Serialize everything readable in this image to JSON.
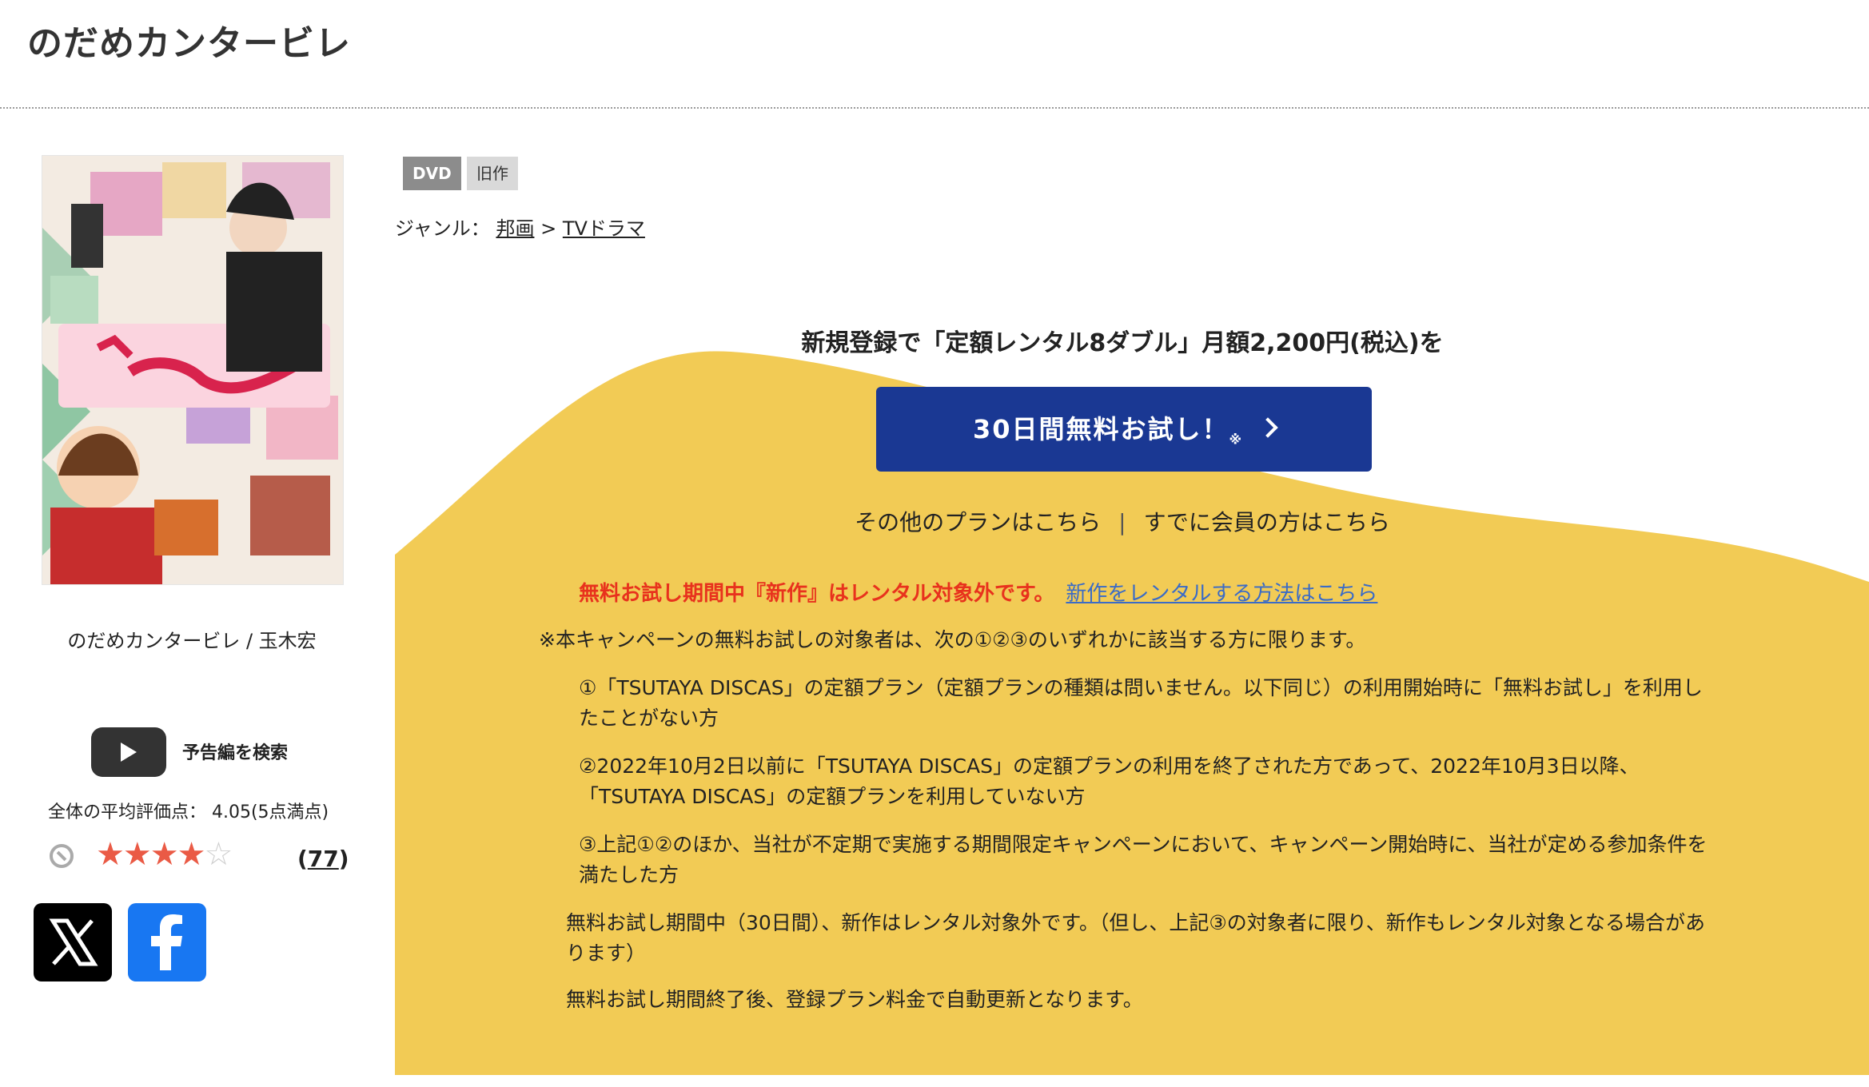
{
  "page": {
    "title": "のだめカンタービレ"
  },
  "product": {
    "cover_label": "のだめカンタービレ / 玉木宏",
    "trailer_label": "予告編を検索",
    "avg_rating_text": "全体の平均評価点： 4.05(5点満点)",
    "rating_value": 4.05,
    "stars_text_on": "★★★★",
    "stars_text_off": "☆",
    "review_count_open": "(",
    "review_count": "77",
    "review_count_close": ")",
    "badges": [
      "DVD",
      "旧作"
    ],
    "genre_prefix": "ジャンル：",
    "genre_items": [
      "邦画",
      "TVドラマ"
    ],
    "genre_sep": ">"
  },
  "share": {
    "x_icon": "x-logo-icon",
    "facebook_icon": "facebook-logo-icon"
  },
  "promo": {
    "headline": "新規登録で「定額レンタル8ダブル」月額2,200円(税込)を",
    "cta_label": "30日間無料お試し！",
    "cta_mark": "※",
    "other_plans": "その他のプランはこちら",
    "link_sep": "|",
    "members": "すでに会員の方はこちら",
    "warning_red": "無料お試し期間中『新作』はレンタル対象外です。",
    "warning_link": "新作をレンタルする方法はこちら",
    "note_intro": "※本キャンペーンの無料お試しの対象者は、次の①②③のいずれかに該当する方に限ります。",
    "cond1": "①「TSUTAYA DISCAS」の定額プラン（定額プランの種類は問いません。以下同じ）の利用開始時に「無料お試し」を利用したことがない方",
    "cond2": "②2022年10月2日以前に「TSUTAYA DISCAS」の定額プランの利用を終了された方であって、2022年10月3日以降、「TSUTAYA DISCAS」の定額プランを利用していない方",
    "cond3": "③上記①②のほか、当社が不定期で実施する期間限定キャンペーンにおいて、キャンペーン開始時に、当社が定める参加条件を満たした方",
    "note_trial": "無料お試し期間中（30日間）、新作はレンタル対象外です。（但し、上記③の対象者に限り、新作もレンタル対象となる場合があります）",
    "note_renew": "無料お試し期間終了後、登録プラン料金で自動更新となります。"
  },
  "colors": {
    "promo_yellow": "#f2cb55",
    "cta_blue": "#1a3893",
    "warning_red": "#e8321d",
    "link_blue": "#3a6bc7",
    "star": "#ea5a45"
  }
}
